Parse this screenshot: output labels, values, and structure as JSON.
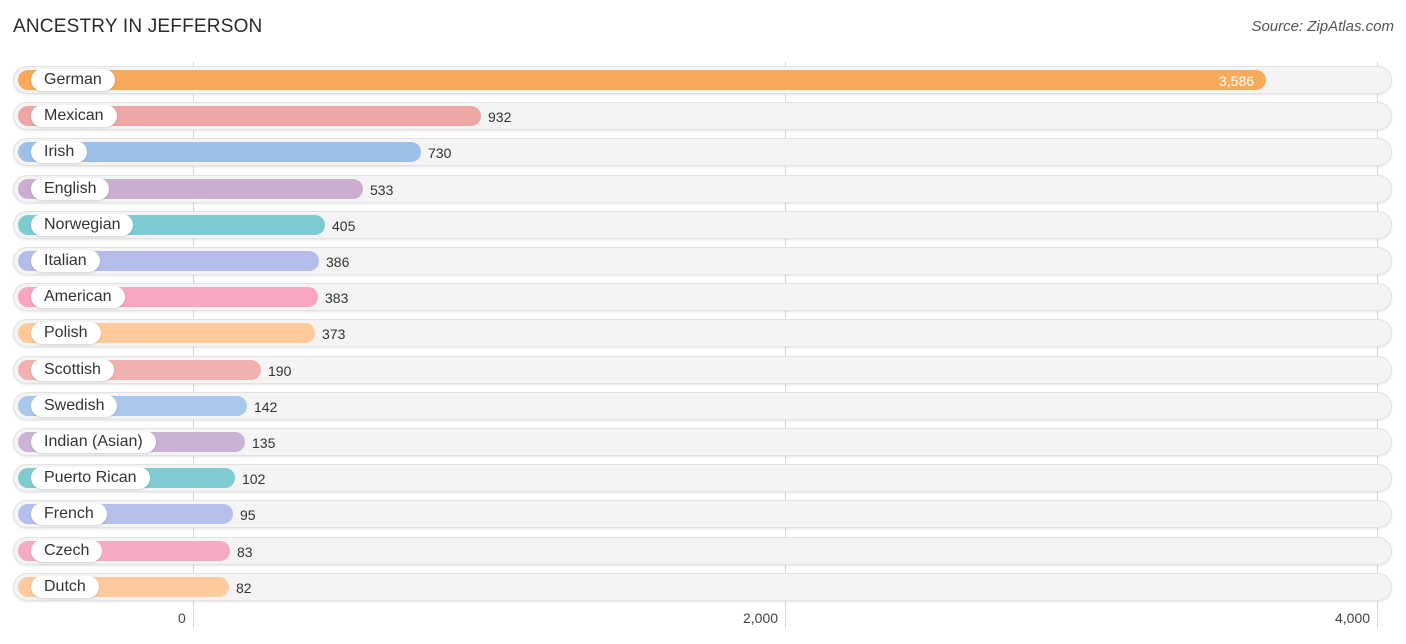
{
  "header": {
    "title": "ANCESTRY IN JEFFERSON",
    "source": "Source: ZipAtlas.com"
  },
  "chart_data": {
    "type": "bar",
    "orientation": "horizontal",
    "title": "ANCESTRY IN JEFFERSON",
    "xlabel": "",
    "ylabel": "",
    "xlim": [
      0,
      4000
    ],
    "grid": true,
    "ticks": [
      {
        "value": 0,
        "label": "0"
      },
      {
        "value": 2000,
        "label": "2,000"
      },
      {
        "value": 4000,
        "label": "4,000"
      }
    ],
    "categories": [
      "German",
      "Mexican",
      "Irish",
      "English",
      "Norwegian",
      "Italian",
      "American",
      "Polish",
      "Scottish",
      "Swedish",
      "Indian (Asian)",
      "Puerto Rican",
      "French",
      "Czech",
      "Dutch"
    ],
    "values": [
      3586,
      932,
      730,
      533,
      405,
      386,
      383,
      373,
      190,
      142,
      135,
      102,
      95,
      83,
      82
    ],
    "value_labels": [
      "3,586",
      "932",
      "730",
      "533",
      "405",
      "386",
      "383",
      "373",
      "190",
      "142",
      "135",
      "102",
      "95",
      "83",
      "82"
    ],
    "colors": [
      "#f9a95a",
      "#eea5a5",
      "#9dc0e8",
      "#c9aed2",
      "#7ccad2",
      "#b4bcea",
      "#f7a5c2",
      "#fdc99a",
      "#f2b1b1",
      "#a9c8ec",
      "#cbb3d6",
      "#7fcbd1",
      "#b6bfec",
      "#f6a9c3",
      "#fcca9c"
    ]
  }
}
